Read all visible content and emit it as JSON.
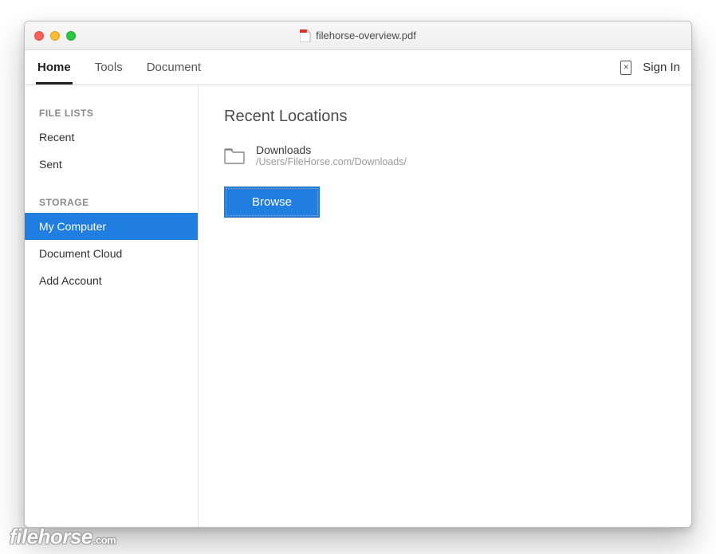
{
  "window": {
    "title": "filehorse-overview.pdf"
  },
  "toolbar": {
    "tabs": [
      {
        "label": "Home",
        "active": true
      },
      {
        "label": "Tools",
        "active": false
      },
      {
        "label": "Document",
        "active": false
      }
    ],
    "signin_label": "Sign In"
  },
  "sidebar": {
    "section_file_lists_label": "FILE LISTS",
    "file_list_items": [
      {
        "label": "Recent"
      },
      {
        "label": "Sent"
      }
    ],
    "section_storage_label": "STORAGE",
    "storage_items": [
      {
        "label": "My Computer",
        "active": true
      },
      {
        "label": "Document Cloud",
        "active": false
      },
      {
        "label": "Add Account",
        "active": false
      }
    ]
  },
  "main": {
    "heading": "Recent Locations",
    "location": {
      "name": "Downloads",
      "path": "/Users/FileHorse.com/Downloads/"
    },
    "browse_label": "Browse"
  },
  "watermark": {
    "brand": "filehorse",
    "suffix": ".com"
  },
  "colors": {
    "accent": "#1f7ee0"
  }
}
